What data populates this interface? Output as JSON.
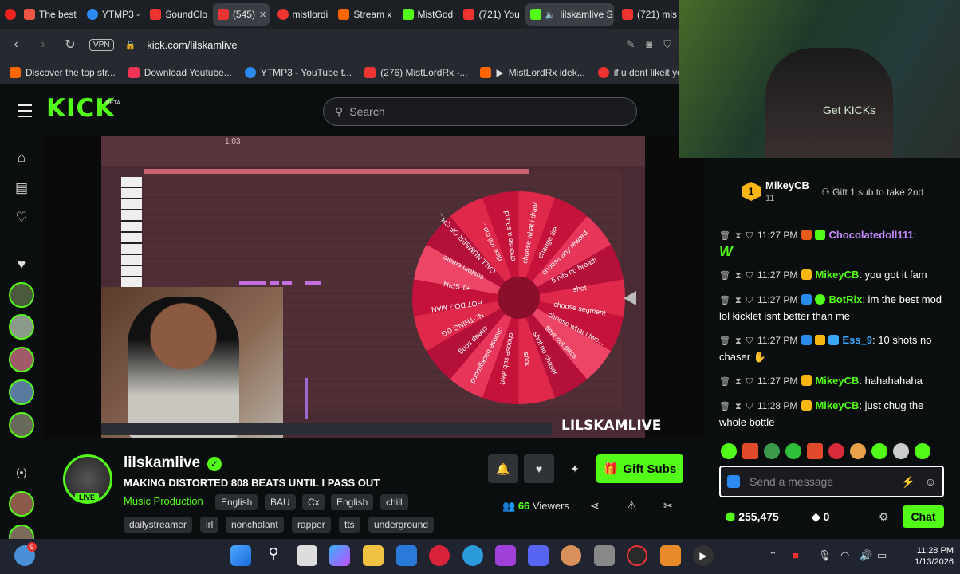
{
  "browser": {
    "tabs": [
      {
        "label": "The best",
        "color": "#e54"
      },
      {
        "label": "YTMP3 -",
        "color": "#2a8af0"
      },
      {
        "label": "SoundClo",
        "color": "#e33"
      },
      {
        "label": "(545)",
        "color": "#e33"
      },
      {
        "label": "mistlordi",
        "color": "#e33"
      },
      {
        "label": "Stream x",
        "color": "#f60"
      },
      {
        "label": "MistGod",
        "color": "#53fc18"
      },
      {
        "label": "(721) You",
        "color": "#e33"
      },
      {
        "label": "lilskamlive S",
        "color": "#53fc18"
      },
      {
        "label": "(721) mis",
        "color": "#e33"
      }
    ],
    "vpn_label": "VPN",
    "url": "kick.com/lilskamlive",
    "bookmarks": [
      {
        "label": "Discover the top str...",
        "color": "#f60"
      },
      {
        "label": "Download Youtube...",
        "color": "#e35"
      },
      {
        "label": "YTMP3 - YouTube t...",
        "color": "#2a8af0"
      },
      {
        "label": "(276) MistLordRx -...",
        "color": "#e33"
      },
      {
        "label": "MistLordRx idek...",
        "color": "#f60"
      },
      {
        "label": "if u dont likeit you b...",
        "color": "#e33"
      }
    ]
  },
  "kick": {
    "logo": "KICK",
    "beta": "BETA",
    "search_placeholder": "Search"
  },
  "video": {
    "watermark": "LILSKAMLIVE",
    "timer": "1:03",
    "wheel_labels": [
      "choose what i draw",
      "change tile",
      "choose any reward",
      "5 hits no breath",
      "shot",
      "choose segment",
      "choose what i twe...",
      "time out pass",
      "shot no chaser",
      "shot",
      "choose sub alert",
      "choose background",
      "cheap song",
      "NOTHING GG",
      "HOT DOG MAN",
      "+1 SPIN",
      "custom emote",
      "CALL NUMBER OF CH...",
      "dice roll mo...",
      "choose a sound"
    ]
  },
  "stream": {
    "streamer": "lilskamlive",
    "live_badge": "LIVE",
    "title": "MAKING DISTORTED 808 BEATS UNTIL I PASS OUT",
    "category": "Music Production",
    "tags_row1": [
      "English",
      "BAU",
      "Cx",
      "English",
      "chill"
    ],
    "tags_row2": [
      "dailystreamer",
      "irl",
      "nonchalant",
      "rapper",
      "tts",
      "underground"
    ],
    "gift_subs": "Gift Subs",
    "viewers_count": "66",
    "viewers_label": "Viewers"
  },
  "facecam": {
    "get_kicks": "Get KICKs"
  },
  "chat": {
    "top_gifter": {
      "rank": "1",
      "name": "MikeyCB",
      "count": "11"
    },
    "gift_hint": "Gift 1 sub to take 2nd",
    "messages": [
      {
        "time": "11:27 PM",
        "user": "Chocolatedoll111",
        "text": ":",
        "extra": "W",
        "user_color": "#c98bff"
      },
      {
        "time": "11:27 PM",
        "user": "MikeyCB",
        "text": ": you got it fam",
        "user_color": "#53fc18"
      },
      {
        "time": "11:27 PM",
        "user": "BotRix",
        "text": ": im the best mod lol kicklet isnt better than me",
        "user_color": "#53fc18"
      },
      {
        "time": "11:27 PM",
        "user": "Ess_9",
        "text": ": 10 shots no chaser",
        "user_color": "#3aa6ff"
      },
      {
        "time": "11:27 PM",
        "user": "MikeyCB",
        "text": ": hahahahaha",
        "user_color": "#53fc18"
      },
      {
        "time": "11:28 PM",
        "user": "MikeyCB",
        "text": ": just chug the whole bottle",
        "user_color": "#53fc18"
      }
    ],
    "input_placeholder": "Send a message",
    "points": "255,475",
    "zero": "0",
    "chat_button": "Chat"
  },
  "taskbar": {
    "time": "11:28 PM",
    "date": "1/13/2026",
    "badge_count": "9"
  },
  "colors": {
    "kick_green": "#53fc18",
    "background": "#0b0e0f",
    "wheel_red": "#e0284a"
  }
}
